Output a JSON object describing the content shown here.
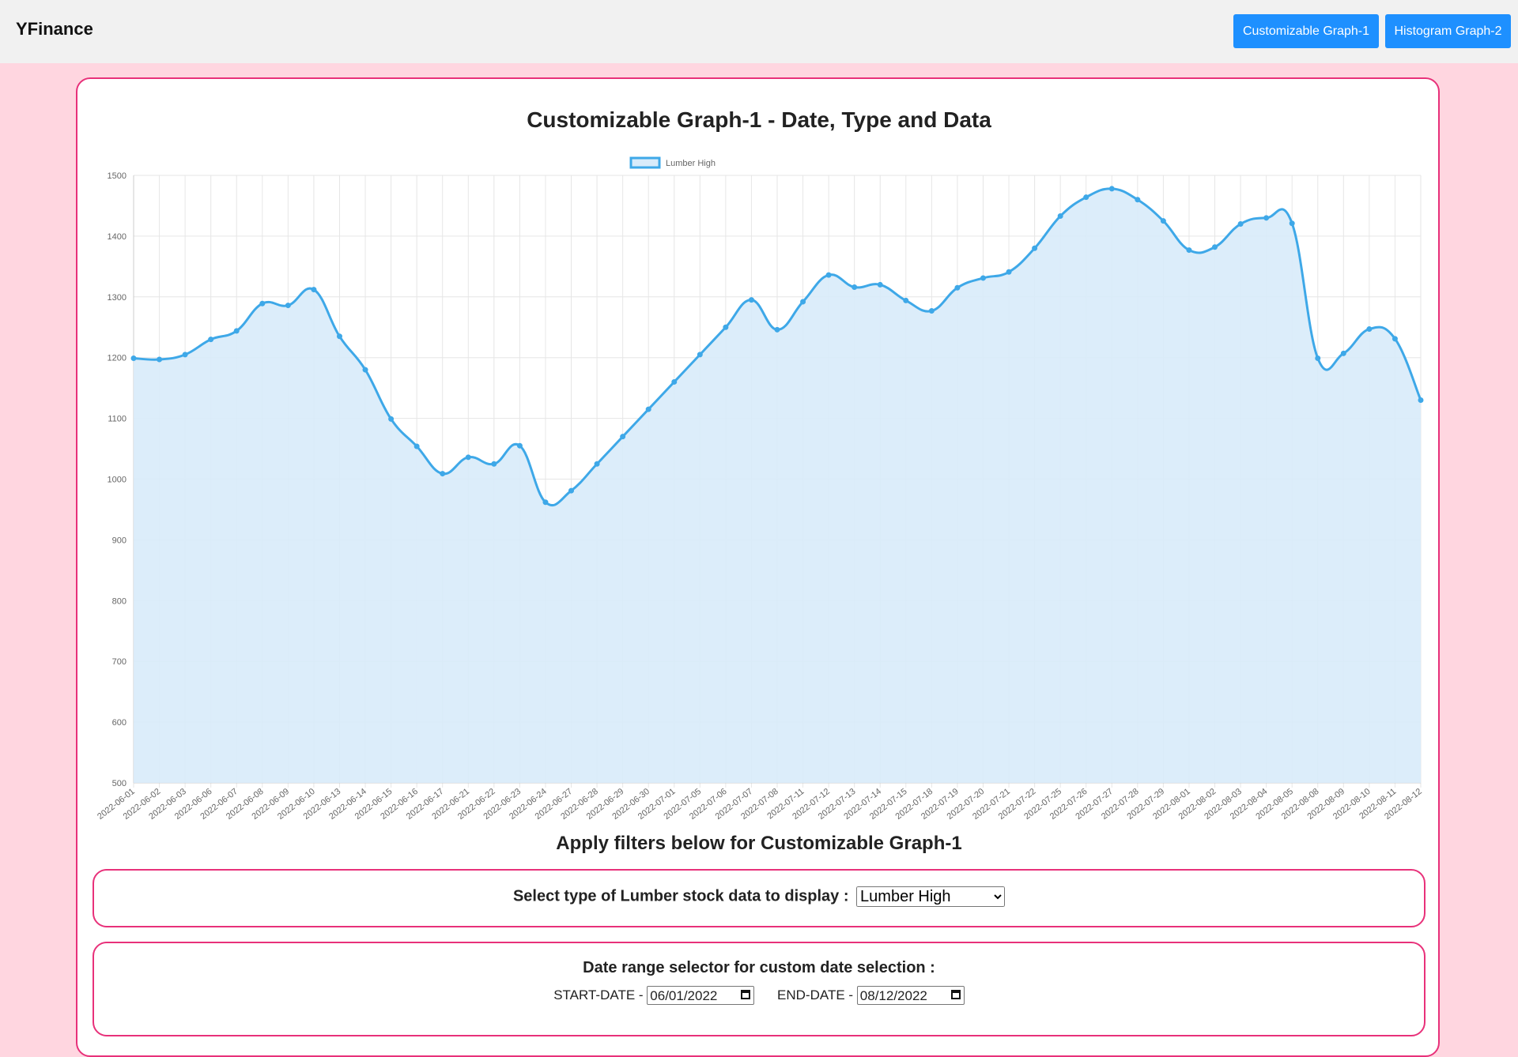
{
  "app": {
    "brand": "YFinance"
  },
  "nav": {
    "buttons": [
      {
        "label": "Customizable Graph-1"
      },
      {
        "label": "Histogram Graph-2"
      }
    ]
  },
  "page": {
    "title": "Customizable Graph-1 - Date, Type and Data",
    "filters_title": "Apply filters below for Customizable Graph-1"
  },
  "type_filter": {
    "label": "Select type of Lumber stock data to display :",
    "selected": "Lumber High"
  },
  "date_filter": {
    "title": "Date range selector for custom date selection :",
    "start_label": "START-DATE -",
    "start_value": "06/01/2022",
    "end_label": "END-DATE -",
    "end_value": "08/12/2022"
  },
  "colors": {
    "accent": "#1e90ff",
    "border": "#e8317a",
    "background": "#ffd6e0",
    "line": "#3ea8e8",
    "fill": "#d8ebfa"
  },
  "chart_data": {
    "type": "area",
    "legend": [
      "Lumber High"
    ],
    "legend_position": "top",
    "grid": true,
    "ylim": [
      500,
      1500
    ],
    "yticks": [
      500,
      600,
      700,
      800,
      900,
      1000,
      1100,
      1200,
      1300,
      1400,
      1500
    ],
    "x": [
      "2022-06-01",
      "2022-06-02",
      "2022-06-03",
      "2022-06-06",
      "2022-06-07",
      "2022-06-08",
      "2022-06-09",
      "2022-06-10",
      "2022-06-13",
      "2022-06-14",
      "2022-06-15",
      "2022-06-16",
      "2022-06-17",
      "2022-06-21",
      "2022-06-22",
      "2022-06-23",
      "2022-06-24",
      "2022-06-27",
      "2022-06-28",
      "2022-06-29",
      "2022-06-30",
      "2022-07-01",
      "2022-07-05",
      "2022-07-06",
      "2022-07-07",
      "2022-07-08",
      "2022-07-11",
      "2022-07-12",
      "2022-07-13",
      "2022-07-14",
      "2022-07-15",
      "2022-07-18",
      "2022-07-19",
      "2022-07-20",
      "2022-07-21",
      "2022-07-22",
      "2022-07-25",
      "2022-07-26",
      "2022-07-27",
      "2022-07-28",
      "2022-07-29",
      "2022-08-01",
      "2022-08-02",
      "2022-08-03",
      "2022-08-04",
      "2022-08-05",
      "2022-08-08",
      "2022-08-09",
      "2022-08-10",
      "2022-08-11",
      "2022-08-12"
    ],
    "series": [
      {
        "name": "Lumber High",
        "values": [
          1199,
          1197,
          1205,
          1230,
          1244,
          1289,
          1286,
          1312,
          1235,
          1180,
          1099,
          1054,
          1009,
          1036,
          1025,
          1055,
          962,
          981,
          1025,
          1070,
          1115,
          1160,
          1205,
          1250,
          1295,
          1246,
          1292,
          1336,
          1316,
          1320,
          1294,
          1277,
          1315,
          1331,
          1341,
          1380,
          1433,
          1464,
          1478,
          1460,
          1425,
          1377,
          1382,
          1420,
          1430,
          1421,
          1199,
          1207,
          1247,
          1231,
          1130
        ]
      }
    ]
  }
}
